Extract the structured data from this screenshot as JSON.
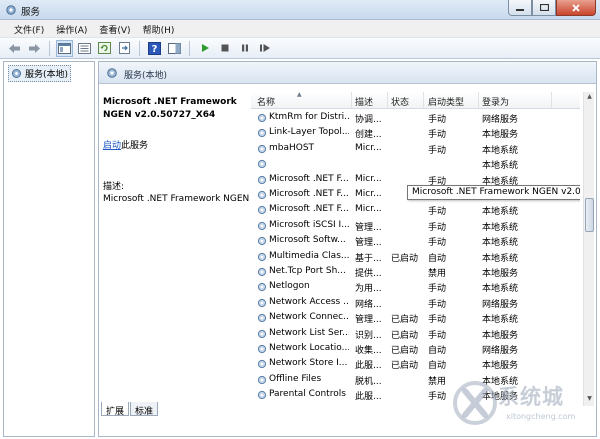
{
  "window": {
    "title": "服务"
  },
  "menu": [
    "文件(F)",
    "操作(A)",
    "查看(V)",
    "帮助(H)"
  ],
  "tree": {
    "root_label": "服务(本地)"
  },
  "pane": {
    "title": "服务(本地)",
    "selected_name_line1": "Microsoft .NET Framework",
    "selected_name_line2": "NGEN v2.0.50727_X64",
    "start_link": "启动",
    "start_suffix": "此服务",
    "desc_label": "描述:",
    "desc_text": "Microsoft .NET Framework NGEN"
  },
  "columns": {
    "name": "名称",
    "desc": "描述",
    "status": "状态",
    "startup": "启动类型",
    "logon": "登录为"
  },
  "services": [
    {
      "name": "KtmRm for Distri...",
      "desc": "协调...",
      "status": "",
      "startup": "手动",
      "logon": "网络服务"
    },
    {
      "name": "Link-Layer Topol...",
      "desc": "创建...",
      "status": "",
      "startup": "手动",
      "logon": "本地服务"
    },
    {
      "name": "mbaHOST",
      "desc": "Micr...",
      "status": "",
      "startup": "手动",
      "logon": "本地系统"
    },
    {
      "name": "",
      "desc": "",
      "status": "",
      "startup": "",
      "logon": "本地系统"
    },
    {
      "name": "Microsoft .NET F...",
      "desc": "Micr...",
      "status": "",
      "startup": "手动",
      "logon": "本地系统"
    },
    {
      "name": "Microsoft .NET F...",
      "desc": "Micr...",
      "status": "",
      "startup": "手动",
      "logon": "本地系统"
    },
    {
      "name": "Microsoft .NET F...",
      "desc": "Micr...",
      "status": "",
      "startup": "手动",
      "logon": "本地系统"
    },
    {
      "name": "Microsoft iSCSI I...",
      "desc": "管理...",
      "status": "",
      "startup": "手动",
      "logon": "本地系统"
    },
    {
      "name": "Microsoft Softw...",
      "desc": "管理...",
      "status": "",
      "startup": "手动",
      "logon": "本地系统"
    },
    {
      "name": "Multimedia Clas...",
      "desc": "基于...",
      "status": "已启动",
      "startup": "自动",
      "logon": "本地系统"
    },
    {
      "name": "Net.Tcp Port Sh...",
      "desc": "提供...",
      "status": "",
      "startup": "禁用",
      "logon": "本地服务"
    },
    {
      "name": "Netlogon",
      "desc": "为用...",
      "status": "",
      "startup": "手动",
      "logon": "本地系统"
    },
    {
      "name": "Network Access ...",
      "desc": "网络...",
      "status": "",
      "startup": "手动",
      "logon": "网络服务"
    },
    {
      "name": "Network Connec...",
      "desc": "管理...",
      "status": "已启动",
      "startup": "手动",
      "logon": "本地系统"
    },
    {
      "name": "Network List Ser...",
      "desc": "识别...",
      "status": "已启动",
      "startup": "手动",
      "logon": "本地服务"
    },
    {
      "name": "Network Locatio...",
      "desc": "收集...",
      "status": "已启动",
      "startup": "自动",
      "logon": "网络服务"
    },
    {
      "name": "Network Store I...",
      "desc": "此服...",
      "status": "已启动",
      "startup": "自动",
      "logon": "本地服务"
    },
    {
      "name": "Offline Files",
      "desc": "脱机...",
      "status": "",
      "startup": "禁用",
      "logon": "本地系统"
    },
    {
      "name": "Parental Controls",
      "desc": "此服...",
      "status": "",
      "startup": "手动",
      "logon": "本地服务"
    }
  ],
  "tooltip": "Microsoft .NET Framework NGEN v2.0.50727_X64",
  "tabs": [
    "扩展",
    "标准"
  ],
  "watermark": {
    "cn": "系统城",
    "en": "xitongcheng.com"
  },
  "colors": {
    "accent": "#3a6ea5",
    "link": "#1a56c8",
    "gear": "#5a7fa8"
  }
}
